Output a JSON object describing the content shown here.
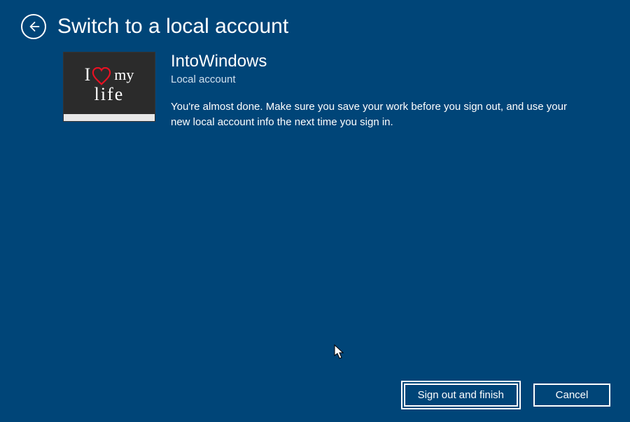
{
  "header": {
    "title": "Switch to a local account"
  },
  "account": {
    "name": "IntoWindows",
    "type": "Local account",
    "avatar": {
      "line1_i": "I",
      "line1_my": "my",
      "line2": "life"
    }
  },
  "description": "You're almost done. Make sure you save your work before you sign out, and use your new local account info the next time you sign in.",
  "buttons": {
    "primary": "Sign out and finish",
    "cancel": "Cancel"
  }
}
